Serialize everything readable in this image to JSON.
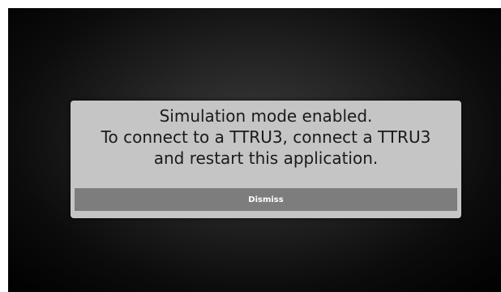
{
  "dialog": {
    "message_lines": [
      "Simulation mode enabled.",
      "To connect to a TTRU3, connect a TTRU3",
      "and restart this application."
    ],
    "dismiss_label": "Dismiss"
  },
  "colors": {
    "dialog_background": "#c5c5c5",
    "button_background": "#7d7d7d",
    "button_text": "#ffffff",
    "message_text": "#1a1a1a",
    "screen_background": "#000000"
  }
}
